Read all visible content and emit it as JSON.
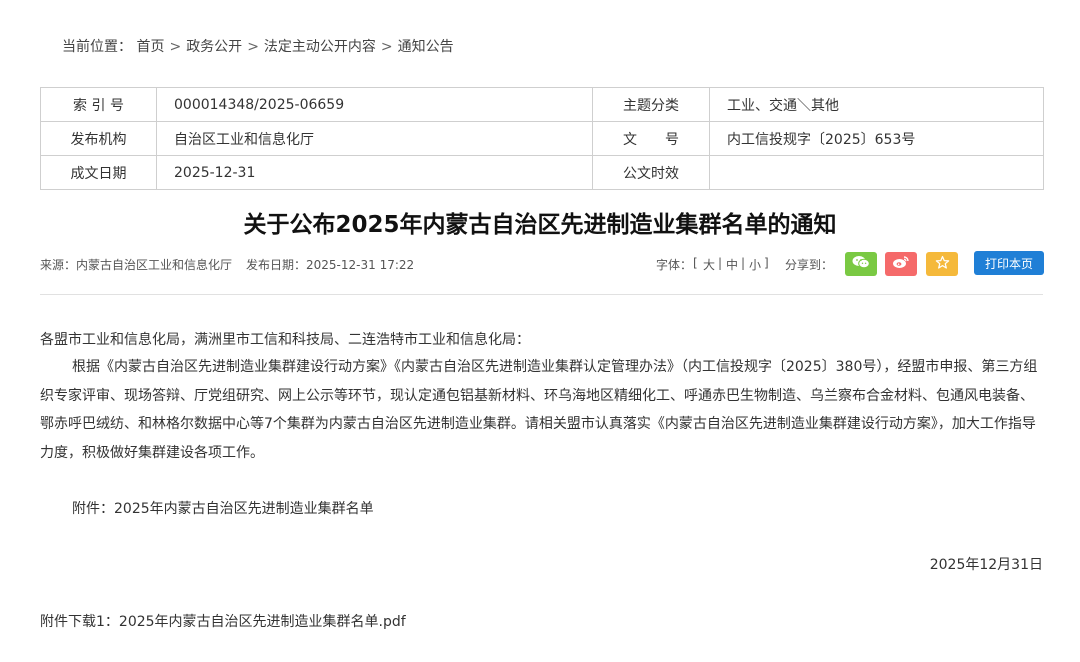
{
  "breadcrumb": {
    "label": "当前位置：",
    "items": [
      "首页",
      "政务公开",
      "法定主动公开内容",
      "通知公告"
    ],
    "separator": ">"
  },
  "meta": {
    "index_label": "索 引 号",
    "index_value": "000014348/2025-06659",
    "topic_label": "主题分类",
    "topic_value": "工业、交通＼其他",
    "publisher_label": "发布机构",
    "publisher_value": "自治区工业和信息化厅",
    "docno_label": "文　　号",
    "docno_value": "内工信投规字〔2025〕653号",
    "date_label": "成文日期",
    "date_value": "2025-12-31",
    "validity_label": "公文时效",
    "validity_value": ""
  },
  "article": {
    "title": "关于公布2025年内蒙古自治区先进制造业集群名单的通知",
    "source": "来源：内蒙古自治区工业和信息化厅",
    "publish_date": "发布日期：2025-12-31 17:22",
    "salutation": "各盟市工业和信息化局，满洲里市工信和科技局、二连浩特市工业和信息化局：",
    "paragraph": "根据《内蒙古自治区先进制造业集群建设行动方案》《内蒙古自治区先进制造业集群认定管理办法》（内工信投规字〔2025〕380号），经盟市申报、第三方组织专家评审、现场答辩、厅党组研究、网上公示等环节，现认定通包铝基新材料、环乌海地区精细化工、呼通赤巴生物制造、乌兰察布合金材料、包通风电装备、鄂赤呼巴绒纺、和林格尔数据中心等7个集群为内蒙古自治区先进制造业集群。请相关盟市认真落实《内蒙古自治区先进制造业集群建设行动方案》，加大工作指导力度，积极做好集群建设各项工作。",
    "attachment": "附件：2025年内蒙古自治区先进制造业集群名单",
    "sign_date": "2025年12月31日",
    "download": "附件下载1：2025年内蒙古自治区先进制造业集群名单.pdf"
  },
  "toolbar": {
    "font_label": "字体：",
    "font_open": "[",
    "font_large": "大",
    "font_medium": "中",
    "font_small": "小",
    "font_close": "]",
    "font_sep": "|",
    "share_label": "分享到：",
    "print_label": "打印本页"
  },
  "share": {
    "wechat_color": "#7ac943",
    "weibo_color": "#f56a6a",
    "qzone_color": "#f5b93b",
    "print_color": "#1f7fd6"
  },
  "icons": [
    "wechat-icon",
    "weibo-icon",
    "star-icon"
  ]
}
